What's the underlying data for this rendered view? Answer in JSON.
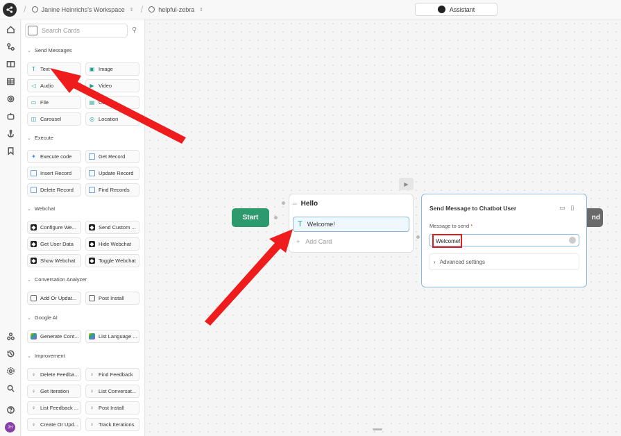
{
  "topbar": {
    "workspace": "Janine Heinrichs's Workspace",
    "bot": "helpful-zebra",
    "assistant_label": "Assistant"
  },
  "rail": {
    "icons": [
      "home-icon",
      "flow-icon",
      "book-icon",
      "table-icon",
      "integrations-icon",
      "bot-icon",
      "anchor-icon",
      "bookmark-icon"
    ],
    "bottom_icons": [
      "hub-icon",
      "history-icon",
      "settings-icon",
      "search-icon",
      "help-icon"
    ],
    "avatar_initials": "JH"
  },
  "panel": {
    "search_placeholder": "Search Cards",
    "sections": [
      {
        "title": "Send Messages",
        "cards": [
          {
            "label": "Text",
            "icon": "text-icon"
          },
          {
            "label": "Image",
            "icon": "image-icon"
          },
          {
            "label": "Audio",
            "icon": "audio-icon"
          },
          {
            "label": "Video",
            "icon": "video-icon"
          },
          {
            "label": "File",
            "icon": "file-icon"
          },
          {
            "label": "Card",
            "icon": "card-icon"
          },
          {
            "label": "Carousel",
            "icon": "carousel-icon"
          },
          {
            "label": "Location",
            "icon": "location-icon"
          }
        ]
      },
      {
        "title": "Execute",
        "cards": [
          {
            "label": "Execute code",
            "icon": "code-icon"
          },
          {
            "label": "Get Record",
            "icon": "table-icon"
          },
          {
            "label": "Insert Record",
            "icon": "table-icon"
          },
          {
            "label": "Update Record",
            "icon": "table-icon"
          },
          {
            "label": "Delete Record",
            "icon": "table-icon"
          },
          {
            "label": "Find Records",
            "icon": "table-icon"
          }
        ]
      },
      {
        "title": "Webchat",
        "cards": [
          {
            "label": "Configure We...",
            "icon": "webchat-icon"
          },
          {
            "label": "Send Custom ...",
            "icon": "webchat-icon"
          },
          {
            "label": "Get User Data",
            "icon": "webchat-icon"
          },
          {
            "label": "Hide Webchat",
            "icon": "webchat-icon"
          },
          {
            "label": "Show Webchat",
            "icon": "webchat-icon"
          },
          {
            "label": "Toggle Webchat",
            "icon": "webchat-icon"
          }
        ]
      },
      {
        "title": "Conversation Analyzer",
        "cards": [
          {
            "label": "Add Or Updat...",
            "icon": "chat-icon"
          },
          {
            "label": "Post Install",
            "icon": "chat-icon"
          }
        ]
      },
      {
        "title": "Google AI",
        "cards": [
          {
            "label": "Generate Cont...",
            "icon": "gemini-icon"
          },
          {
            "label": "List Language ...",
            "icon": "gemini-icon"
          }
        ]
      },
      {
        "title": "Improvement",
        "cards": [
          {
            "label": "Delete Feedba...",
            "icon": "bulb-icon"
          },
          {
            "label": "Find Feedback",
            "icon": "bulb-icon"
          },
          {
            "label": "Get Iteration",
            "icon": "bulb-icon"
          },
          {
            "label": "List Conversat...",
            "icon": "bulb-icon"
          },
          {
            "label": "List Feedback ...",
            "icon": "bulb-icon"
          },
          {
            "label": "Post Install",
            "icon": "bulb-icon"
          },
          {
            "label": "Create Or Upd...",
            "icon": "bulb-icon"
          },
          {
            "label": "Track Iterations",
            "icon": "bulb-icon"
          }
        ]
      }
    ]
  },
  "canvas": {
    "start_label": "Start",
    "end_label": "nd",
    "hello_node": {
      "title": "Hello",
      "card_text": "Welcome!",
      "add_card": "Add Card"
    },
    "send_node": {
      "title": "Send Message to Chatbot User",
      "field_label": "Message to send",
      "required_mark": "*",
      "field_value": "Welcome!",
      "advanced": "Advanced settings"
    }
  },
  "colors": {
    "accent_green": "#2d9a6e",
    "highlight_red": "#e01b1b",
    "selection_blue": "#8ab8e0"
  }
}
